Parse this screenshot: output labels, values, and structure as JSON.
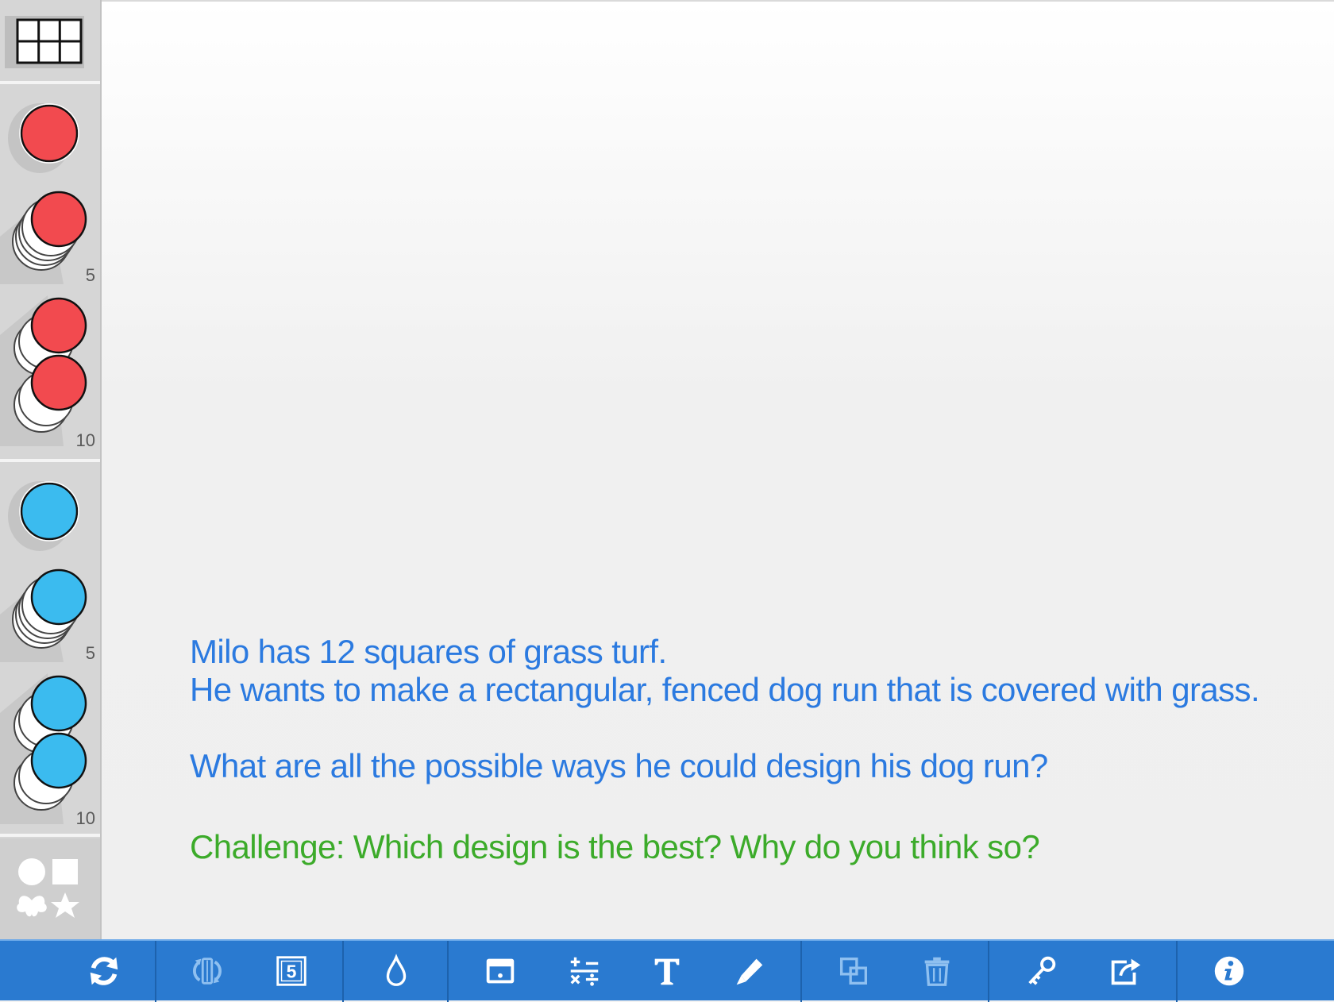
{
  "sidebar": {
    "red_group": [
      {
        "name": "red-counter-single",
        "count_label": ""
      },
      {
        "name": "red-counter-stack-5",
        "count_label": "5"
      },
      {
        "name": "red-counter-stack-10",
        "count_label": "10"
      }
    ],
    "blue_group": [
      {
        "name": "blue-counter-single",
        "count_label": ""
      },
      {
        "name": "blue-counter-stack-5",
        "count_label": "5"
      },
      {
        "name": "blue-counter-stack-10",
        "count_label": "10"
      }
    ],
    "colors": {
      "red": "#f24a4f",
      "blue": "#3bbbef",
      "panel": "#d6d6d6"
    }
  },
  "canvas": {
    "lines": [
      "Milo has 12 squares of grass turf.",
      "He wants to make a rectangular, fenced dog run that is covered with grass."
    ],
    "question": "What are all the possible ways he could design his dog run?",
    "challenge": "Challenge: Which design is the best? Why do you think so?",
    "colors": {
      "text": "#2b7ae0",
      "challenge": "#3cab2a"
    }
  },
  "toolbar": {
    "color": "#2a7ad0",
    "buttons": [
      "refresh-icon",
      "flip-icon",
      "number-card-icon",
      "color-drop-icon",
      "background-icon",
      "operations-icon",
      "text-icon",
      "pen-icon",
      "duplicate-icon",
      "trash-icon",
      "key-icon",
      "share-icon",
      "info-icon"
    ],
    "number_card_value": "5"
  }
}
